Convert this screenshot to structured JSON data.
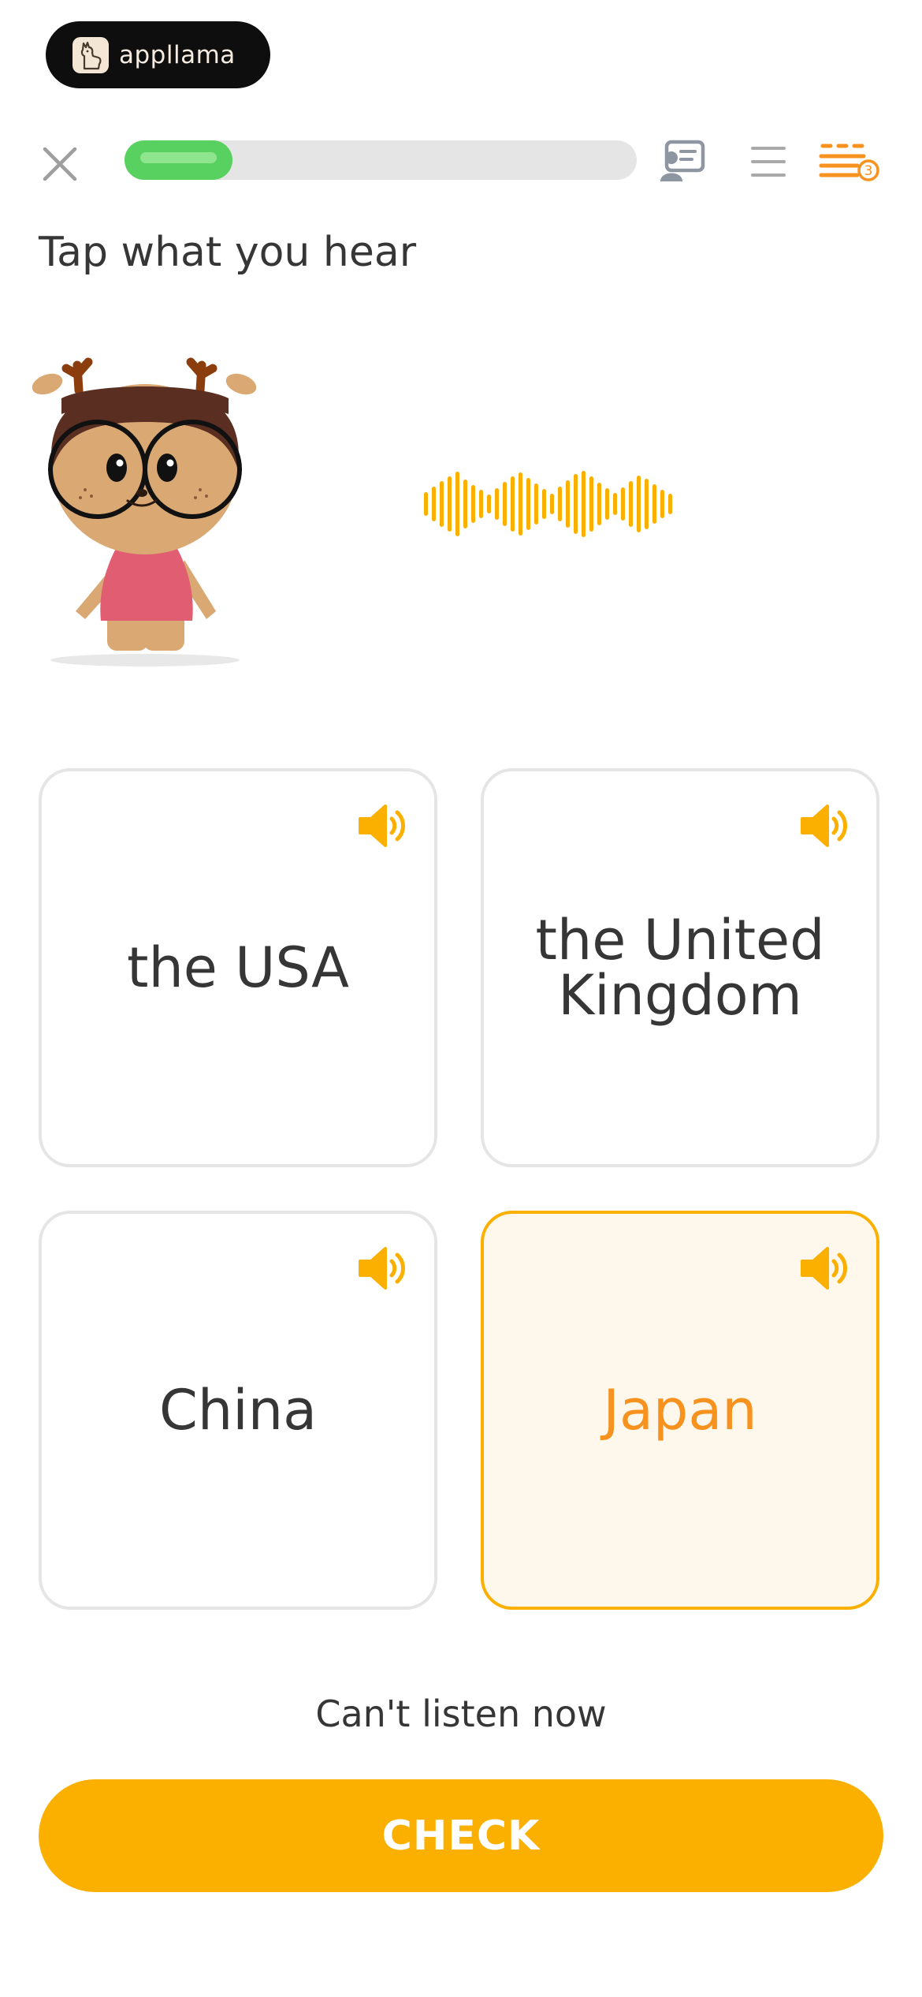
{
  "brand": {
    "name": "appllama",
    "logo_icon": "llama-icon"
  },
  "top_bar": {
    "close_icon": "close-icon",
    "progress": 0.21,
    "progress_color": "#58d160",
    "tip_icon": "tip-card-icon",
    "menu_icon": "menu-icon",
    "settings_icon": "sliders-icon",
    "settings_badge": "3"
  },
  "prompt": "Tap what you hear",
  "audio": {
    "icon": "sound-wave-icon",
    "color": "#fbb000"
  },
  "choices": [
    {
      "label": "the USA",
      "selected": false,
      "speaker_icon": "speaker-icon"
    },
    {
      "label": "the United Kingdom",
      "selected": false,
      "speaker_icon": "speaker-icon"
    },
    {
      "label": "China",
      "selected": false,
      "speaker_icon": "speaker-icon"
    },
    {
      "label": "Japan",
      "selected": true,
      "speaker_icon": "speaker-icon"
    }
  ],
  "cant_listen_label": "Can't listen now",
  "check_label": "CHECK",
  "colors": {
    "accent": "#fbb000",
    "selected_text": "#f7921e",
    "selected_bg": "#fdf7ec",
    "card_border": "#e5e5e5"
  }
}
